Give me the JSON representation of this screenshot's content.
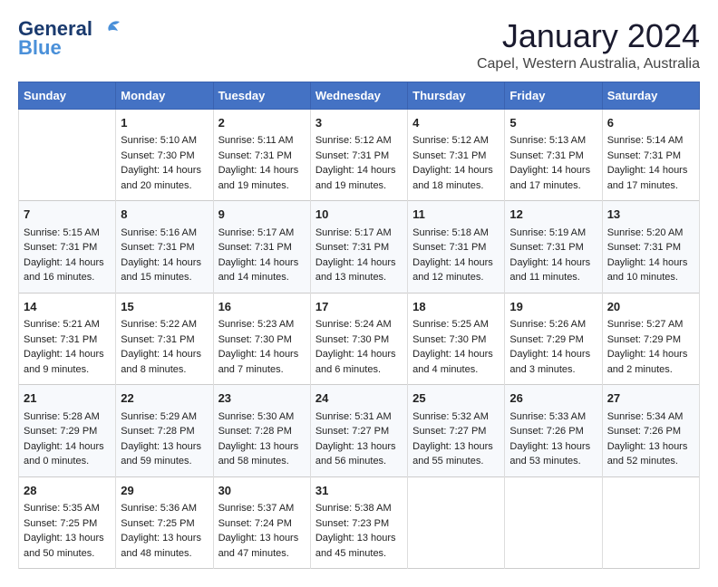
{
  "app": {
    "logo_line1": "General",
    "logo_line2": "Blue"
  },
  "title": "January 2024",
  "location": "Capel, Western Australia, Australia",
  "days_of_week": [
    "Sunday",
    "Monday",
    "Tuesday",
    "Wednesday",
    "Thursday",
    "Friday",
    "Saturday"
  ],
  "weeks": [
    [
      {
        "day": "",
        "lines": []
      },
      {
        "day": "1",
        "lines": [
          "Sunrise: 5:10 AM",
          "Sunset: 7:30 PM",
          "Daylight: 14 hours",
          "and 20 minutes."
        ]
      },
      {
        "day": "2",
        "lines": [
          "Sunrise: 5:11 AM",
          "Sunset: 7:31 PM",
          "Daylight: 14 hours",
          "and 19 minutes."
        ]
      },
      {
        "day": "3",
        "lines": [
          "Sunrise: 5:12 AM",
          "Sunset: 7:31 PM",
          "Daylight: 14 hours",
          "and 19 minutes."
        ]
      },
      {
        "day": "4",
        "lines": [
          "Sunrise: 5:12 AM",
          "Sunset: 7:31 PM",
          "Daylight: 14 hours",
          "and 18 minutes."
        ]
      },
      {
        "day": "5",
        "lines": [
          "Sunrise: 5:13 AM",
          "Sunset: 7:31 PM",
          "Daylight: 14 hours",
          "and 17 minutes."
        ]
      },
      {
        "day": "6",
        "lines": [
          "Sunrise: 5:14 AM",
          "Sunset: 7:31 PM",
          "Daylight: 14 hours",
          "and 17 minutes."
        ]
      }
    ],
    [
      {
        "day": "7",
        "lines": [
          "Sunrise: 5:15 AM",
          "Sunset: 7:31 PM",
          "Daylight: 14 hours",
          "and 16 minutes."
        ]
      },
      {
        "day": "8",
        "lines": [
          "Sunrise: 5:16 AM",
          "Sunset: 7:31 PM",
          "Daylight: 14 hours",
          "and 15 minutes."
        ]
      },
      {
        "day": "9",
        "lines": [
          "Sunrise: 5:17 AM",
          "Sunset: 7:31 PM",
          "Daylight: 14 hours",
          "and 14 minutes."
        ]
      },
      {
        "day": "10",
        "lines": [
          "Sunrise: 5:17 AM",
          "Sunset: 7:31 PM",
          "Daylight: 14 hours",
          "and 13 minutes."
        ]
      },
      {
        "day": "11",
        "lines": [
          "Sunrise: 5:18 AM",
          "Sunset: 7:31 PM",
          "Daylight: 14 hours",
          "and 12 minutes."
        ]
      },
      {
        "day": "12",
        "lines": [
          "Sunrise: 5:19 AM",
          "Sunset: 7:31 PM",
          "Daylight: 14 hours",
          "and 11 minutes."
        ]
      },
      {
        "day": "13",
        "lines": [
          "Sunrise: 5:20 AM",
          "Sunset: 7:31 PM",
          "Daylight: 14 hours",
          "and 10 minutes."
        ]
      }
    ],
    [
      {
        "day": "14",
        "lines": [
          "Sunrise: 5:21 AM",
          "Sunset: 7:31 PM",
          "Daylight: 14 hours",
          "and 9 minutes."
        ]
      },
      {
        "day": "15",
        "lines": [
          "Sunrise: 5:22 AM",
          "Sunset: 7:31 PM",
          "Daylight: 14 hours",
          "and 8 minutes."
        ]
      },
      {
        "day": "16",
        "lines": [
          "Sunrise: 5:23 AM",
          "Sunset: 7:30 PM",
          "Daylight: 14 hours",
          "and 7 minutes."
        ]
      },
      {
        "day": "17",
        "lines": [
          "Sunrise: 5:24 AM",
          "Sunset: 7:30 PM",
          "Daylight: 14 hours",
          "and 6 minutes."
        ]
      },
      {
        "day": "18",
        "lines": [
          "Sunrise: 5:25 AM",
          "Sunset: 7:30 PM",
          "Daylight: 14 hours",
          "and 4 minutes."
        ]
      },
      {
        "day": "19",
        "lines": [
          "Sunrise: 5:26 AM",
          "Sunset: 7:29 PM",
          "Daylight: 14 hours",
          "and 3 minutes."
        ]
      },
      {
        "day": "20",
        "lines": [
          "Sunrise: 5:27 AM",
          "Sunset: 7:29 PM",
          "Daylight: 14 hours",
          "and 2 minutes."
        ]
      }
    ],
    [
      {
        "day": "21",
        "lines": [
          "Sunrise: 5:28 AM",
          "Sunset: 7:29 PM",
          "Daylight: 14 hours",
          "and 0 minutes."
        ]
      },
      {
        "day": "22",
        "lines": [
          "Sunrise: 5:29 AM",
          "Sunset: 7:28 PM",
          "Daylight: 13 hours",
          "and 59 minutes."
        ]
      },
      {
        "day": "23",
        "lines": [
          "Sunrise: 5:30 AM",
          "Sunset: 7:28 PM",
          "Daylight: 13 hours",
          "and 58 minutes."
        ]
      },
      {
        "day": "24",
        "lines": [
          "Sunrise: 5:31 AM",
          "Sunset: 7:27 PM",
          "Daylight: 13 hours",
          "and 56 minutes."
        ]
      },
      {
        "day": "25",
        "lines": [
          "Sunrise: 5:32 AM",
          "Sunset: 7:27 PM",
          "Daylight: 13 hours",
          "and 55 minutes."
        ]
      },
      {
        "day": "26",
        "lines": [
          "Sunrise: 5:33 AM",
          "Sunset: 7:26 PM",
          "Daylight: 13 hours",
          "and 53 minutes."
        ]
      },
      {
        "day": "27",
        "lines": [
          "Sunrise: 5:34 AM",
          "Sunset: 7:26 PM",
          "Daylight: 13 hours",
          "and 52 minutes."
        ]
      }
    ],
    [
      {
        "day": "28",
        "lines": [
          "Sunrise: 5:35 AM",
          "Sunset: 7:25 PM",
          "Daylight: 13 hours",
          "and 50 minutes."
        ]
      },
      {
        "day": "29",
        "lines": [
          "Sunrise: 5:36 AM",
          "Sunset: 7:25 PM",
          "Daylight: 13 hours",
          "and 48 minutes."
        ]
      },
      {
        "day": "30",
        "lines": [
          "Sunrise: 5:37 AM",
          "Sunset: 7:24 PM",
          "Daylight: 13 hours",
          "and 47 minutes."
        ]
      },
      {
        "day": "31",
        "lines": [
          "Sunrise: 5:38 AM",
          "Sunset: 7:23 PM",
          "Daylight: 13 hours",
          "and 45 minutes."
        ]
      },
      {
        "day": "",
        "lines": []
      },
      {
        "day": "",
        "lines": []
      },
      {
        "day": "",
        "lines": []
      }
    ]
  ]
}
